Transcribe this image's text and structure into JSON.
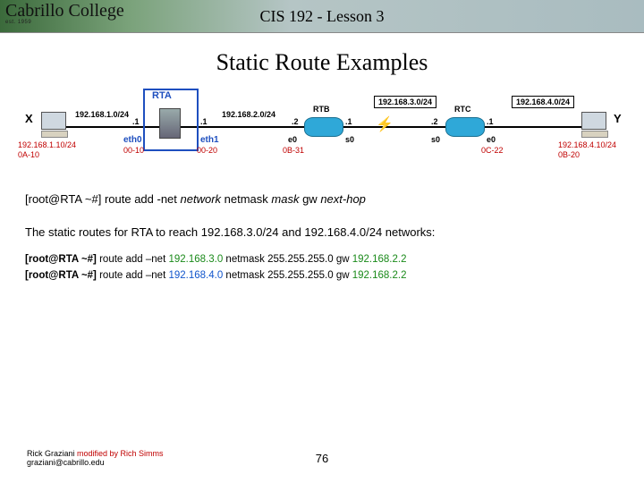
{
  "header": {
    "college": "Cabrillo College",
    "est": "est. 1959",
    "lesson": "CIS 192 - Lesson 3"
  },
  "title": "Static Route Examples",
  "diagram": {
    "x": "X",
    "y": "Y",
    "rta": "RTA",
    "eth0": "eth0",
    "eth1": "eth1",
    "rtb": "RTB",
    "rtc": "RTC",
    "net1": "192.168.1.0/24",
    "net2": "192.168.2.0/24",
    "net3": "192.168.3.0/24",
    "net4": "192.168.4.0/24",
    "hostX_ip": "192.168.1.10/24",
    "hostX_mac": "0A-10",
    "hostY_ip": "192.168.4.10/24",
    "hostY_mac": "0B-20",
    "rta_e0_ip": ".1",
    "rta_e0_mac": "00-10",
    "rta_e1_ip": ".1",
    "rta_e1_mac": "00-20",
    "rtb_e0_ip": ".2",
    "rtb_e0_mac": "0B-31",
    "rtb_s0_ip": ".1",
    "rtc_s0_ip": ".2",
    "rtc_e0_ip": ".1",
    "rtc_e0_mac": "0C-22",
    "e0": "e0",
    "s0": "s0"
  },
  "syntax": {
    "prompt": "[root@RTA ~#] ",
    "cmd": "route add -net ",
    "arg_net": "network",
    "kw_mask": " netmask ",
    "arg_mask": "mask",
    "kw_gw": " gw ",
    "arg_gw": "next-hop"
  },
  "explain": "The static routes for RTA to reach 192.168.3.0/24 and 192.168.4.0/24 networks:",
  "cmds": [
    {
      "prompt": "[root@RTA ~#] ",
      "pre": "route add –net ",
      "net": "192.168.3.0",
      "mid": " netmask 255.255.255.0 gw ",
      "gw": "192.168.2.2"
    },
    {
      "prompt": "[root@RTA ~#] ",
      "pre": "route add –net ",
      "net": "192.168.4.0",
      "mid": " netmask 255.255.255.0 gw ",
      "gw": "192.168.2.2"
    }
  ],
  "footer": {
    "author": "Rick Graziani ",
    "mod": "modified by Rich Simms",
    "email": "graziani@cabrillo.edu"
  },
  "page": "76"
}
